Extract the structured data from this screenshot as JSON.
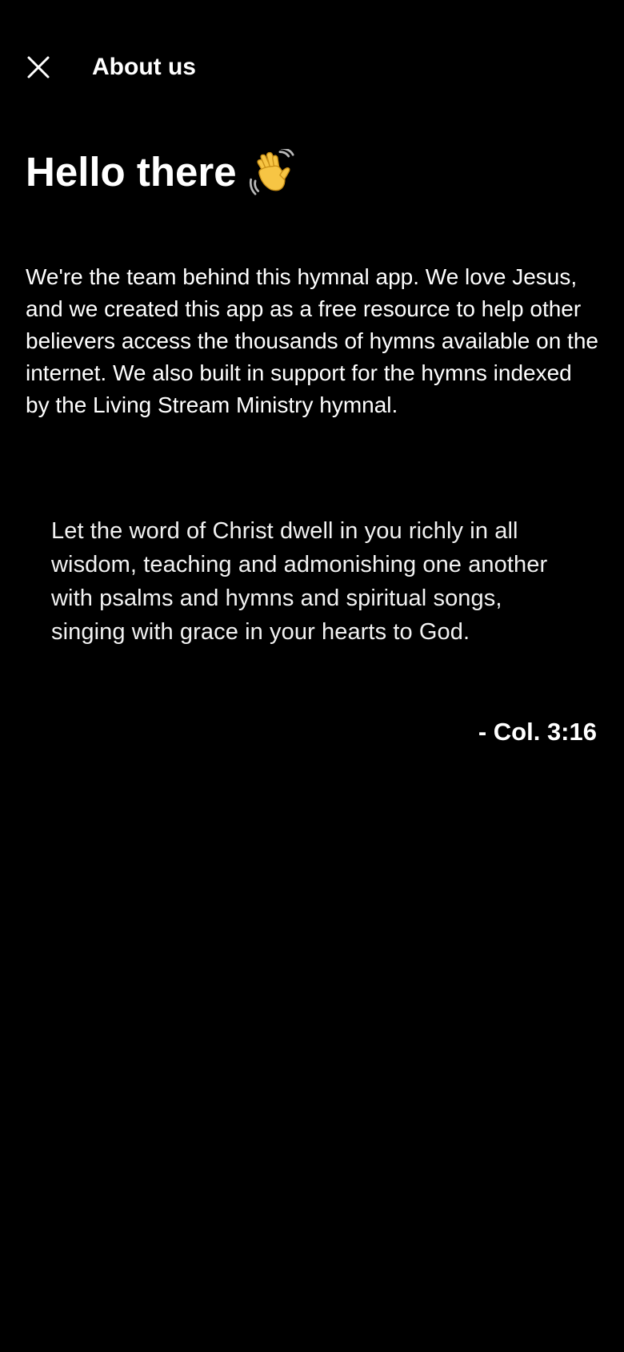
{
  "header": {
    "close_icon": "close-icon",
    "title": "About us"
  },
  "content": {
    "greeting": "Hello there",
    "greeting_emoji": "waving-hand-icon",
    "intro": "We're the team behind this hymnal app. We love Jesus, and we created this app as a free resource to help other believers access the thousands of hymns available on the internet. We also built in support for the hymns indexed by the Living Stream Ministry hymnal.",
    "verse": "Let the word of Christ dwell in you richly in all wisdom, teaching and admonishing one another with psalms and hymns and spiritual songs, singing with grace in your hearts to God.",
    "citation": "- Col. 3:16"
  },
  "colors": {
    "background": "#000000",
    "text": "#ffffff",
    "emoji_skin": "#f7c544"
  }
}
